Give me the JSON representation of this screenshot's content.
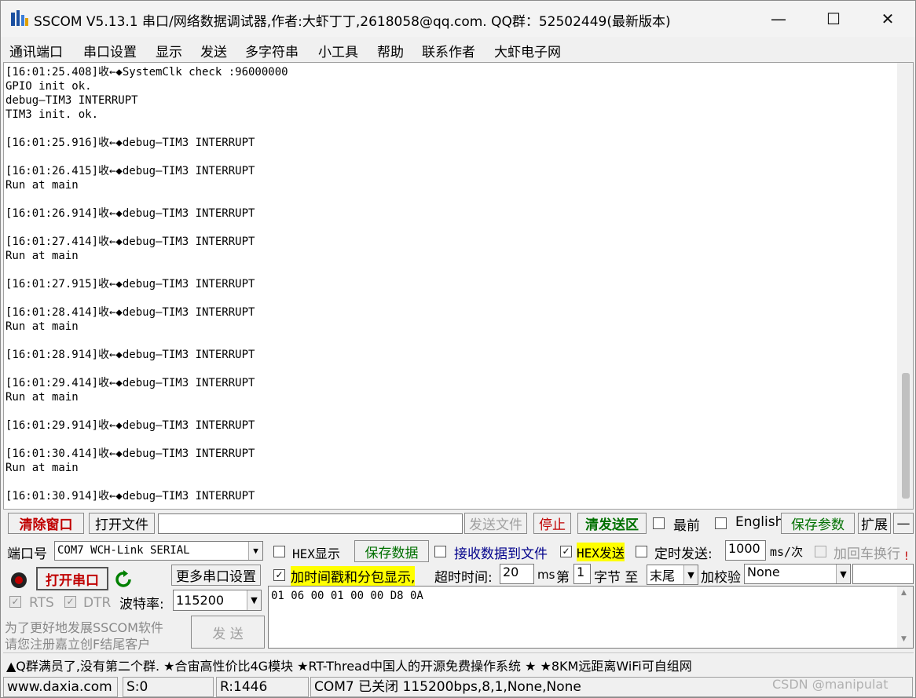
{
  "title": "SSCOM V5.13.1 串口/网络数据调试器,作者:大虾丁丁,2618058@qq.com. QQ群：52502449(最新版本)",
  "window_controls": {
    "minimize": "—",
    "maximize": "☐",
    "close": "✕"
  },
  "menu": [
    "通讯端口",
    "串口设置",
    "显示",
    "发送",
    "多字符串",
    "小工具",
    "帮助",
    "联系作者",
    "大虾电子网"
  ],
  "receive_lines": [
    "[16:01:25.408]收←◆SystemClk check :96000000",
    "GPIO init ok.",
    "debug—TIM3 INTERRUPT",
    "TIM3 init. ok.",
    "",
    "[16:01:25.916]收←◆debug—TIM3 INTERRUPT",
    "",
    "[16:01:26.415]收←◆debug—TIM3 INTERRUPT",
    "Run at main",
    "",
    "[16:01:26.914]收←◆debug—TIM3 INTERRUPT",
    "",
    "[16:01:27.414]收←◆debug—TIM3 INTERRUPT",
    "Run at main",
    "",
    "[16:01:27.915]收←◆debug—TIM3 INTERRUPT",
    "",
    "[16:01:28.414]收←◆debug—TIM3 INTERRUPT",
    "Run at main",
    "",
    "[16:01:28.914]收←◆debug—TIM3 INTERRUPT",
    "",
    "[16:01:29.414]收←◆debug—TIM3 INTERRUPT",
    "Run at main",
    "",
    "[16:01:29.914]收←◆debug—TIM3 INTERRUPT",
    "",
    "[16:01:30.414]收←◆debug—TIM3 INTERRUPT",
    "Run at main",
    "",
    "[16:01:30.914]收←◆debug—TIM3 INTERRUPT"
  ],
  "toolbar": {
    "clear_window": "清除窗口",
    "open_file": "打开文件",
    "send_file": "发送文件",
    "stop": "停止",
    "clear_send": "清发送区",
    "most_front": "最前",
    "english": "English",
    "save_params": "保存参数",
    "expand": "扩展",
    "collapse": "—"
  },
  "port": {
    "port_label": "端口号",
    "port_value": "COM7 WCH-Link SERIAL",
    "open_port": "打开串口",
    "more_settings": "更多串口设置",
    "rts": "RTS",
    "dtr": "DTR",
    "baud_label": "波特率:",
    "baud_value": "115200"
  },
  "options": {
    "hex_display": "HEX显示",
    "save_data": "保存数据",
    "recv_to_file": "接收数据到文件",
    "hex_send": "HEX发送",
    "timed_send": "定时发送:",
    "timed_value": "1000",
    "ms_per": "ms/次",
    "add_crlf": "加回车换行",
    "timestamp": "加时间戳和分包显示,",
    "timeout_label": "超时时间:",
    "timeout_value": "20",
    "ms": "ms",
    "nth": "第",
    "nth_value": "1",
    "byte_to": "字节 至",
    "tail": "末尾",
    "checksum_label": "加校验",
    "checksum_value": "None"
  },
  "send_data": "01 06 00 01 00 00 D8 0A",
  "send_button": "发 送",
  "promo": [
    "为了更好地发展SSCOM软件",
    "请您注册嘉立创F结尾客户"
  ],
  "ticker": "▲Q群满员了,没有第二个群. ★合宙高性价比4G模块 ★RT-Thread中国人的开源免费操作系统 ★ ★8KM远距离WiFi可自组网",
  "status": {
    "website": "www.daxia.com",
    "sent": "S:0",
    "received": "R:1446",
    "port_state": "COM7 已关闭  115200bps,8,1,None,None"
  },
  "watermark": "CSDN @manipulat",
  "colors": {
    "accent_red": "#c00000",
    "green_text": "#007000",
    "highlight_yellow": "#ffff00"
  }
}
